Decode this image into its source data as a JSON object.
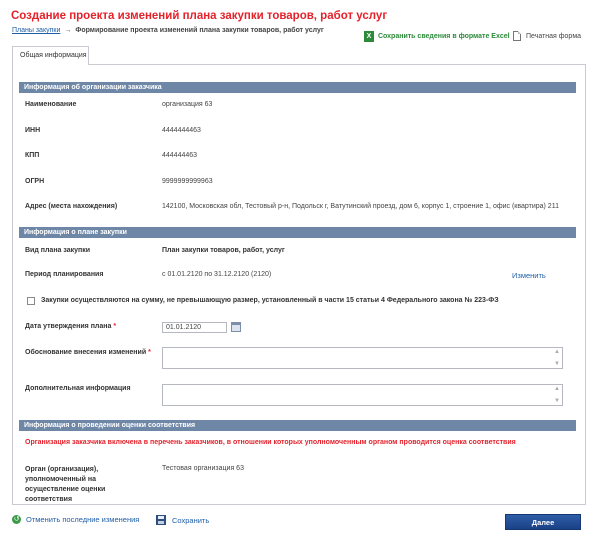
{
  "title": "Создание проекта изменений плана закупки товаров, работ услуг",
  "breadcrumb": {
    "link": "Планы закупки",
    "arrow": "→",
    "current": "Формирование проекта изменений плана закупки товаров, работ услуг"
  },
  "actions": {
    "excel": "Сохранить сведения в формате Excel",
    "print": "Печатная форма"
  },
  "tab": "Общая информация",
  "customer_section": {
    "header": "Информация об организации заказчика",
    "fields": [
      {
        "label": "Наименование",
        "value": "организация 63"
      },
      {
        "label": "ИНН",
        "value": "4444444463"
      },
      {
        "label": "КПП",
        "value": "444444463"
      },
      {
        "label": "ОГРН",
        "value": "9999999999963"
      },
      {
        "label": "Адрес (места нахождения)",
        "value": "142100, Московская обл, Тестовый р-н, Подольск г, Ватутинский проезд, дом 6, корпус 1, строение 1, офис (квартира) 211"
      }
    ]
  },
  "plan_section": {
    "header": "Информация о плане закупки",
    "type_label": "Вид плана закупки",
    "type_value": "План закупки товаров, работ, услуг",
    "period_label": "Период планирования",
    "period_value": "с 01.01.2120 по 31.12.2120 (2120)",
    "change_link": "Изменить",
    "checkbox_label": "Закупки осуществляются на сумму, не превышающую размер, установленный в части 15 статьи 4 Федерального закона № 223-ФЗ",
    "date_label": "Дата утверждения плана",
    "date_value": "01.01.2120",
    "reason_label": "Обоснование внесения изменений",
    "additional_label": "Дополнительная информация",
    "required_mark": "*"
  },
  "assessment_section": {
    "header": "Информация о проведении оценки соответствия",
    "notice": "Организация заказчика включена в перечень заказчиков, в отношении которых уполномоченным органом проводится оценка соответствия",
    "org_label": "Орган (организация), уполномоченный на осуществление оценки соответствия",
    "org_value": "Тестовая организация 63"
  },
  "footer": {
    "undo": "Отменить последние изменения",
    "save": "Сохранить",
    "next": "Далее"
  },
  "colors": {
    "title_red": "#e4222b",
    "section_header": "#6f87a7",
    "link_blue": "#1f5fa8",
    "excel_green": "#2c8a3a",
    "button_blue": "#1a4186"
  },
  "icons": [
    "excel-icon",
    "print-icon",
    "calendar-icon",
    "undo-icon",
    "save-icon"
  ]
}
